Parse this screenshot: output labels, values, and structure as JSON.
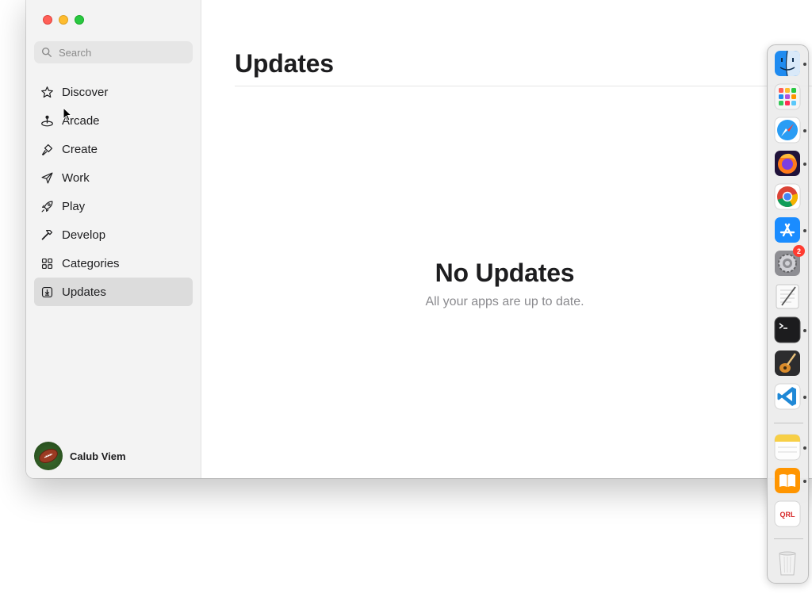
{
  "sidebar": {
    "search_placeholder": "Search",
    "items": [
      {
        "label": "Discover",
        "icon": "star-icon"
      },
      {
        "label": "Arcade",
        "icon": "joystick-icon"
      },
      {
        "label": "Create",
        "icon": "brush-icon"
      },
      {
        "label": "Work",
        "icon": "paper-plane-icon"
      },
      {
        "label": "Play",
        "icon": "rocket-icon"
      },
      {
        "label": "Develop",
        "icon": "hammer-icon"
      },
      {
        "label": "Categories",
        "icon": "grid-icon"
      },
      {
        "label": "Updates",
        "icon": "download-icon",
        "selected": true
      }
    ],
    "user": {
      "name": "Calub Viem",
      "avatar": "football-avatar"
    }
  },
  "main": {
    "title": "Updates",
    "empty_title": "No Updates",
    "empty_subtitle": "All your apps are up to date."
  },
  "dock": {
    "items": [
      {
        "name": "Finder",
        "icon": "finder-icon",
        "running": true
      },
      {
        "name": "Launchpad",
        "icon": "launchpad-icon",
        "running": false
      },
      {
        "name": "Safari",
        "icon": "safari-icon",
        "running": true
      },
      {
        "name": "Firefox",
        "icon": "firefox-icon",
        "running": true
      },
      {
        "name": "Google Chrome",
        "icon": "chrome-icon",
        "running": false
      },
      {
        "name": "App Store",
        "icon": "app-store-icon",
        "running": true
      },
      {
        "name": "System Settings",
        "icon": "system-settings-icon",
        "running": false,
        "badge": "2"
      },
      {
        "name": "TextEdit",
        "icon": "textedit-icon",
        "running": false
      },
      {
        "name": "Terminal",
        "icon": "terminal-icon",
        "running": true
      },
      {
        "name": "GarageBand",
        "icon": "garageband-icon",
        "running": false
      },
      {
        "name": "Visual Studio Code",
        "icon": "vscode-icon",
        "running": true
      },
      {
        "name": "Notes",
        "icon": "notes-icon",
        "running": true
      },
      {
        "name": "Books",
        "icon": "books-icon",
        "running": true
      },
      {
        "name": "QRL",
        "icon": "qrl-icon",
        "label": "QRL",
        "running": false
      },
      {
        "name": "Trash",
        "icon": "trash-icon",
        "running": false
      }
    ]
  },
  "colors": {
    "sidebar_bg": "#f3f3f3",
    "selected_bg": "#dcdcdc",
    "traffic_close": "#ff5f57",
    "traffic_minimize": "#febc2e",
    "traffic_zoom": "#28c840",
    "badge": "#ff3b30"
  }
}
